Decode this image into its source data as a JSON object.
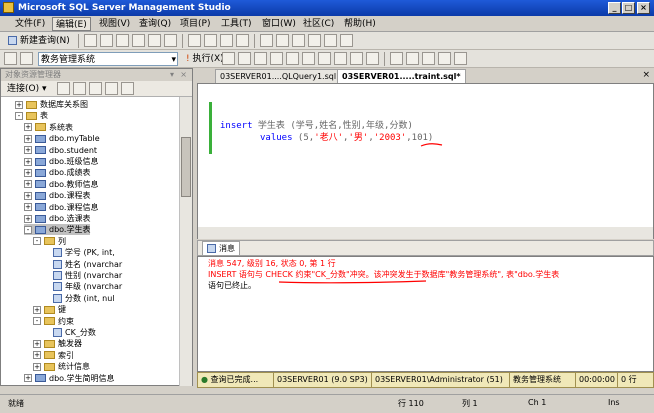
{
  "window": {
    "title": "Microsoft SQL Server Management Studio"
  },
  "menu": [
    "文件(F)",
    "编辑(E)",
    "视图(V)",
    "查询(Q)",
    "项目(P)",
    "工具(T)",
    "窗口(W)",
    "社区(C)",
    "帮助(H)"
  ],
  "toolbar1": {
    "new_query": "新建查询(N)"
  },
  "toolbar2": {
    "database": "教务管理系统",
    "execute": "执行(X)"
  },
  "object_explorer": {
    "title": "对象资源管理器",
    "connect": "连接(O)",
    "tree": [
      {
        "label": "数据库关系图",
        "indent": 4,
        "exp": "+",
        "icon": "folder"
      },
      {
        "label": "表",
        "indent": 4,
        "exp": "-",
        "icon": "folder"
      },
      {
        "label": "系统表",
        "indent": 5,
        "exp": "+",
        "icon": "folder"
      },
      {
        "label": "dbo.myTable",
        "indent": 5,
        "exp": "+",
        "icon": "table"
      },
      {
        "label": "dbo.student",
        "indent": 5,
        "exp": "+",
        "icon": "table"
      },
      {
        "label": "dbo.班级信息",
        "indent": 5,
        "exp": "+",
        "icon": "table"
      },
      {
        "label": "dbo.成绩表",
        "indent": 5,
        "exp": "+",
        "icon": "table"
      },
      {
        "label": "dbo.教师信息",
        "indent": 5,
        "exp": "+",
        "icon": "table"
      },
      {
        "label": "dbo.课程表",
        "indent": 5,
        "exp": "+",
        "icon": "table"
      },
      {
        "label": "dbo.课程信息",
        "indent": 5,
        "exp": "+",
        "icon": "table"
      },
      {
        "label": "dbo.选课表",
        "indent": 5,
        "exp": "+",
        "icon": "table"
      },
      {
        "label": "dbo.学生表",
        "indent": 5,
        "exp": "-",
        "icon": "table",
        "selected": true
      },
      {
        "label": "列",
        "indent": 6,
        "exp": "-",
        "icon": "folder"
      },
      {
        "label": "学号 (PK, int,",
        "indent": 7,
        "exp": "",
        "icon": "col"
      },
      {
        "label": "姓名 (nvarchar",
        "indent": 7,
        "exp": "",
        "icon": "col"
      },
      {
        "label": "性别 (nvarchar",
        "indent": 7,
        "exp": "",
        "icon": "col"
      },
      {
        "label": "年级 (nvarchar",
        "indent": 7,
        "exp": "",
        "icon": "col"
      },
      {
        "label": "分数 (int, nul",
        "indent": 7,
        "exp": "",
        "icon": "col"
      },
      {
        "label": "键",
        "indent": 6,
        "exp": "+",
        "icon": "folder"
      },
      {
        "label": "约束",
        "indent": 6,
        "exp": "-",
        "icon": "folder"
      },
      {
        "label": "CK_分数",
        "indent": 7,
        "exp": "",
        "icon": "col"
      },
      {
        "label": "触发器",
        "indent": 6,
        "exp": "+",
        "icon": "folder"
      },
      {
        "label": "索引",
        "indent": 6,
        "exp": "+",
        "icon": "folder"
      },
      {
        "label": "统计信息",
        "indent": 6,
        "exp": "+",
        "icon": "folder"
      },
      {
        "label": "dbo.学生简明信息",
        "indent": 5,
        "exp": "+",
        "icon": "table"
      }
    ]
  },
  "tabs": [
    {
      "label": "03SERVER01....QLQuery1.sql"
    },
    {
      "label": "03SERVER01.....traint.sql*"
    }
  ],
  "editor": {
    "line1_kw": "insert",
    "line1_rest": " 学生表 (学号,姓名,性别,年级,分数)",
    "line2_kw": "values",
    "line2_open": " (5,",
    "v1": "'老八'",
    "c1": ",",
    "v2": "'男'",
    "c2": ",",
    "v3": "'2003'",
    "c3": ",101)"
  },
  "messages": {
    "tab": "消息",
    "line1": "消息 547, 级别 16, 状态 0, 第 1 行",
    "line2": "INSERT 语句与 CHECK 约束\"CK_分数\"冲突。该冲突发生于数据库\"教务管理系统\", 表\"dbo.学生表",
    "line3": "语句已终止。"
  },
  "query_status": {
    "state": "查询已完成...",
    "server": "03SERVER01 (9.0 SP3)",
    "user": "03SERVER01\\Administrator (51)",
    "db": "教务管理系统",
    "time": "00:00:00",
    "rows": "0 行"
  },
  "statusbar": {
    "ready": "就绪",
    "row": "行 110",
    "col": "列 1",
    "ch": "Ch 1",
    "ins": "Ins"
  },
  "colors": {
    "title_blue": "#0b3aa8",
    "error_red": "#ff0000",
    "keyword_blue": "#0000ff",
    "gutter_green": "#3ab03a"
  }
}
